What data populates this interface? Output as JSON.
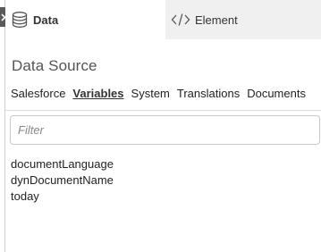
{
  "tabs": {
    "data_label": "Data",
    "element_label": "Element"
  },
  "section_title": "Data Source",
  "subtabs": [
    {
      "label": "Salesforce",
      "active": false
    },
    {
      "label": "Variables",
      "active": true
    },
    {
      "label": "System",
      "active": false
    },
    {
      "label": "Translations",
      "active": false
    },
    {
      "label": "Documents",
      "active": false
    }
  ],
  "filter": {
    "placeholder": "Filter",
    "value": ""
  },
  "variables": [
    "documentLanguage",
    "dynDocumentName",
    "today"
  ],
  "icons": {
    "collapse": "chevron-right-icon",
    "data": "database-icon",
    "element": "code-icon"
  },
  "colors": {
    "active_tab_bg": "#ffffff",
    "inactive_tab_bg": "#f0f0f0",
    "handle": "#5a5a5a"
  }
}
